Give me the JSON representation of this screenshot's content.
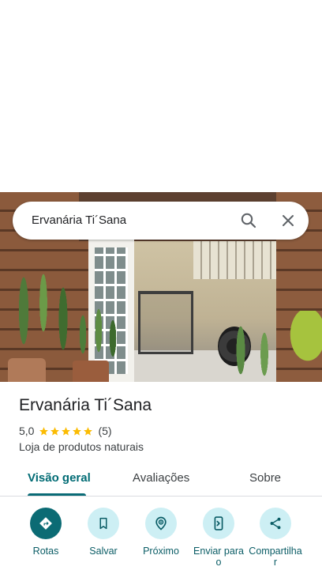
{
  "search": {
    "query": "Ervanária Ti´Sana",
    "search_icon": "search-icon",
    "close_icon": "close-icon"
  },
  "place": {
    "name": "Ervanária Ti´Sana",
    "rating": "5,0",
    "stars": 5,
    "review_count": "(5)",
    "category": "Loja de produtos naturais"
  },
  "tabs": [
    {
      "label": "Visão geral",
      "active": true
    },
    {
      "label": "Avaliações",
      "active": false
    },
    {
      "label": "Sobre",
      "active": false
    }
  ],
  "actions": [
    {
      "label": "Rotas",
      "icon": "directions-icon"
    },
    {
      "label": "Salvar",
      "icon": "bookmark-icon"
    },
    {
      "label": "Próximo",
      "icon": "nearby-icon"
    },
    {
      "label": "Enviar para o",
      "icon": "send-to-phone-icon"
    },
    {
      "label": "Compartilhar",
      "icon": "share-icon"
    }
  ],
  "colors": {
    "accent": "#0b6b74",
    "accent_light": "#cdeff4",
    "star": "#fbbc04",
    "text": "#202124"
  }
}
